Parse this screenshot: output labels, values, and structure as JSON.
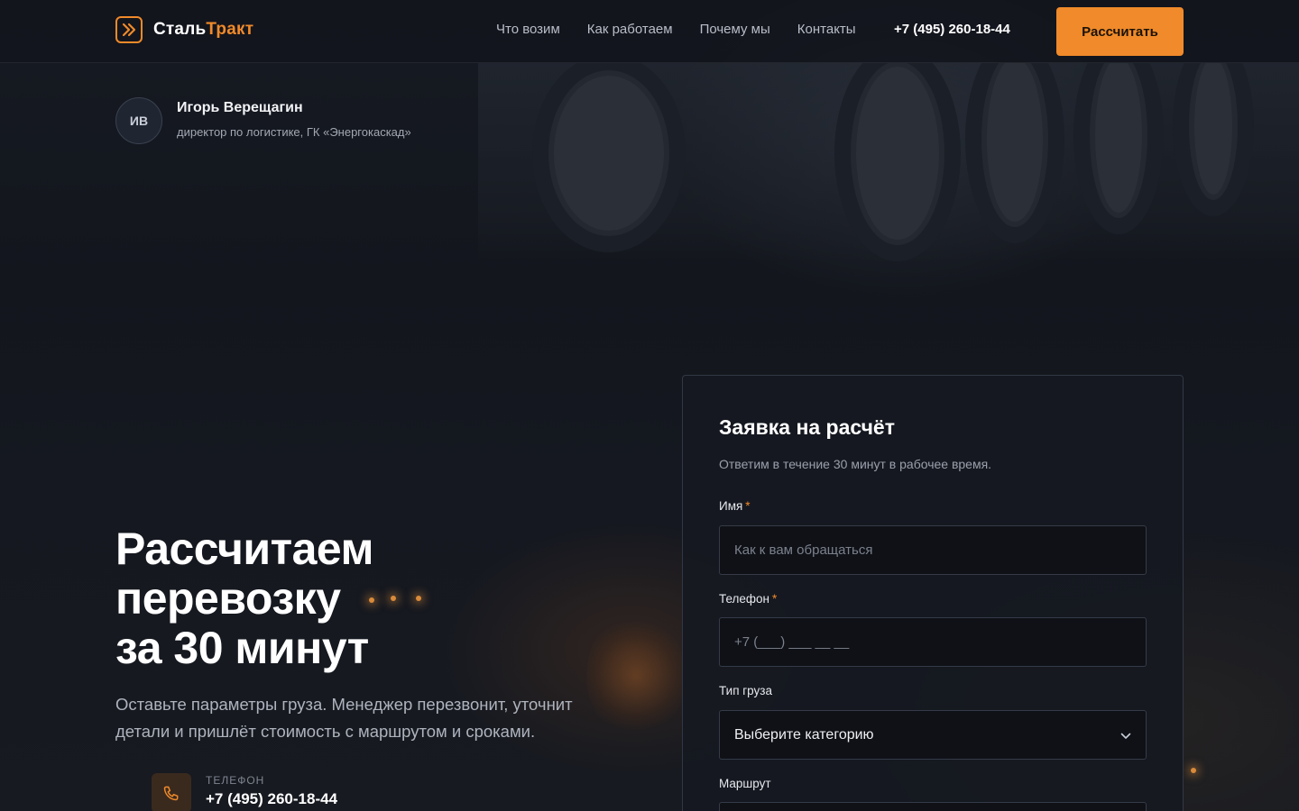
{
  "brand": {
    "name_part1": "Сталь",
    "name_part2": "Тракт",
    "accent_color": "#f08a2a"
  },
  "nav": {
    "items": [
      {
        "label": "Что возим"
      },
      {
        "label": "Как работаем"
      },
      {
        "label": "Почему мы"
      },
      {
        "label": "Контакты"
      }
    ],
    "phone": "+7 (495) 260-18-44",
    "cta_label": "Рассчитать"
  },
  "testimonial": {
    "initials": "ИВ",
    "name": "Игорь Верещагин",
    "role": "директор по логистике, ГК «Энергокаскад»"
  },
  "hero": {
    "title_lines": [
      "Рассчитаем",
      "перевозку",
      "за 30 минут"
    ],
    "subtitle": "Оставьте параметры груза. Менеджер перезвонит, уточнит детали и пришлёт стоимость с маршрутом и сроками.",
    "contact": {
      "label": "ТЕЛЕФОН",
      "value": "+7 (495) 260-18-44",
      "icon": "phone-icon"
    }
  },
  "form": {
    "title": "Заявка на расчёт",
    "subtitle": "Ответим в течение 30 минут в рабочее время.",
    "required_mark": "*",
    "fields": {
      "name": {
        "label": "Имя",
        "placeholder": "Как к вам обращаться"
      },
      "phone": {
        "label": "Телефон",
        "placeholder": "+7 (___) ___ __ __"
      },
      "cargo": {
        "label": "Тип груза",
        "value": "Выберите категорию"
      },
      "route": {
        "label": "Маршрут"
      }
    }
  }
}
